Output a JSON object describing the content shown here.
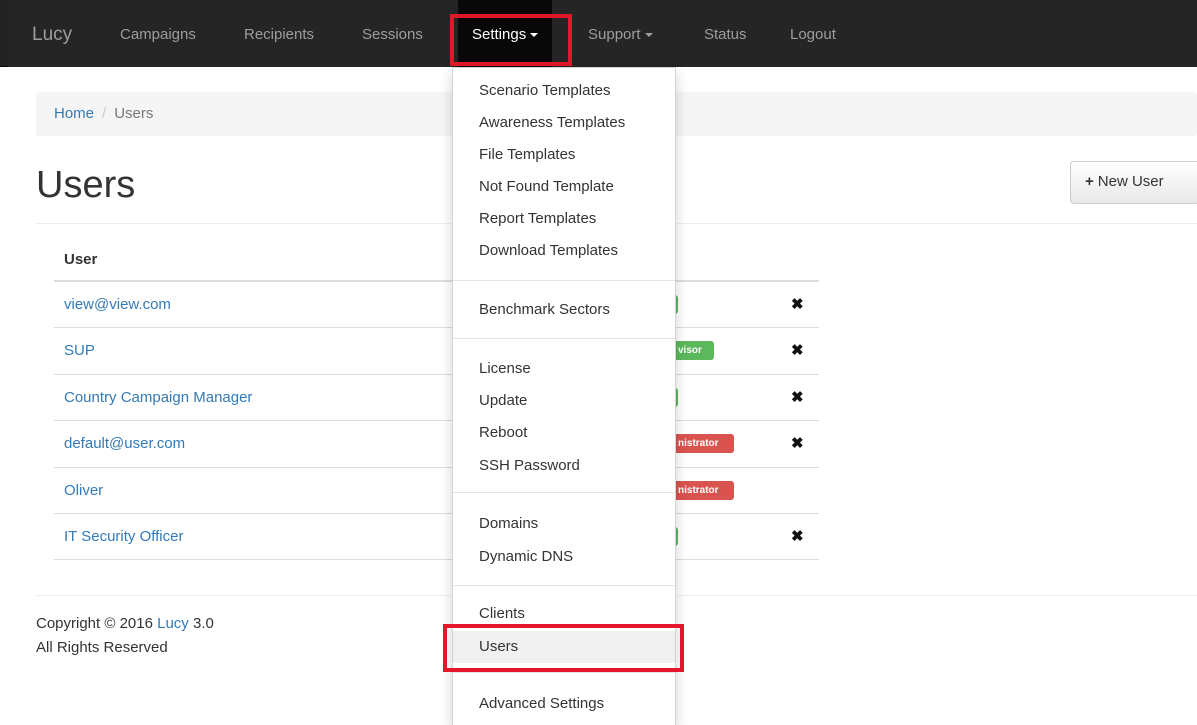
{
  "navbar": {
    "brand": "Lucy",
    "items": [
      "Campaigns",
      "Recipients",
      "Sessions",
      "Settings",
      "Support",
      "Status",
      "Logout"
    ]
  },
  "breadcrumb": {
    "home": "Home",
    "separator": "/",
    "current": "Users"
  },
  "page": {
    "title": "Users",
    "new_user_button": "New User"
  },
  "table": {
    "header": "User",
    "rows": [
      {
        "user": "view@view.com",
        "role_badge": "",
        "badge_color": "green",
        "delete_icon": "✖"
      },
      {
        "user": "SUP",
        "role_badge": "visor",
        "badge_color": "green",
        "delete_icon": "✖"
      },
      {
        "user": "Country Campaign Manager",
        "role_badge": "",
        "badge_color": "green",
        "delete_icon": "✖"
      },
      {
        "user": "default@user.com",
        "role_badge": "nistrator",
        "badge_color": "red",
        "delete_icon": "✖"
      },
      {
        "user": "Oliver",
        "role_badge": "nistrator",
        "badge_color": "red",
        "delete_icon": ""
      },
      {
        "user": "IT Security Officer",
        "role_badge": "",
        "badge_color": "green",
        "delete_icon": "✖"
      }
    ]
  },
  "footer": {
    "copyright": "Copyright © 2016",
    "product_link": "Lucy",
    "version": "3.0",
    "rights": "All Rights Reserved"
  },
  "settings_menu": {
    "group1": [
      "Scenario Templates",
      "Awareness Templates",
      "File Templates",
      "Not Found Template",
      "Report Templates",
      "Download Templates"
    ],
    "group2": [
      "Benchmark Sectors"
    ],
    "group3": [
      "License",
      "Update",
      "Reboot",
      "SSH Password"
    ],
    "group4": [
      "Domains",
      "Dynamic DNS"
    ],
    "group5": [
      "Clients",
      "Users"
    ],
    "group6": [
      "Advanced Settings"
    ],
    "active_item": "Users"
  },
  "colors": {
    "navbar_bg": "#222222",
    "link": "#337ab7",
    "highlight": "#e3162a",
    "badge_green": "#5cb85c",
    "badge_red": "#d9534f"
  }
}
